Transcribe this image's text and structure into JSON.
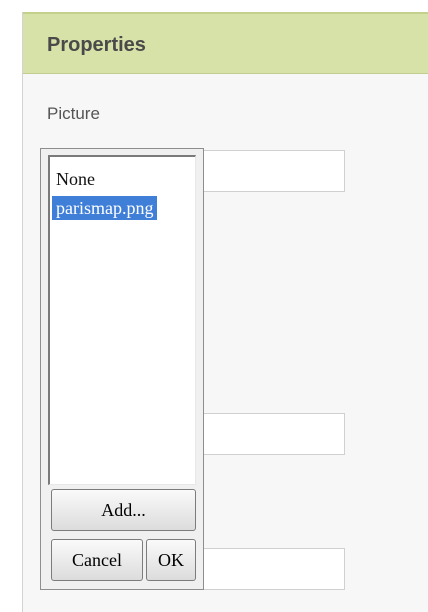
{
  "panel": {
    "title": "Properties",
    "picture_label": "Picture"
  },
  "chooser": {
    "items": [
      {
        "label": "None",
        "selected": false
      },
      {
        "label": "parismap.png",
        "selected": true
      }
    ],
    "add_label": "Add...",
    "cancel_label": "Cancel",
    "ok_label": "OK"
  },
  "colors": {
    "header_bg": "#d6e2a7",
    "selection": "#3f7fd8"
  }
}
